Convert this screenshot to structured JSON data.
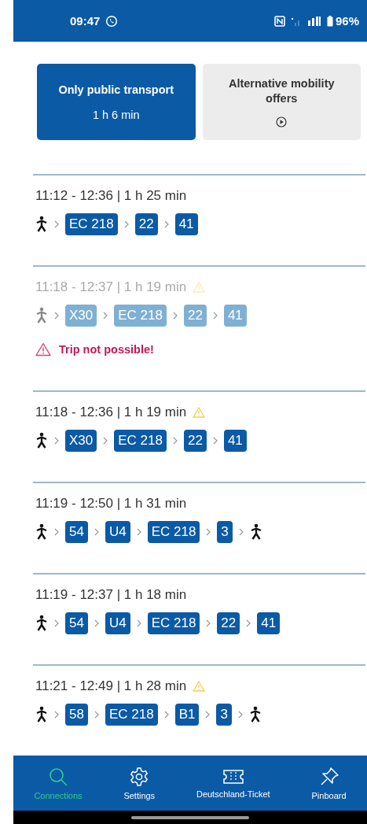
{
  "status_bar": {
    "time": "09:47",
    "battery": "96%"
  },
  "tabs": [
    {
      "label": "Only public transport",
      "detail": "1 h 6 min",
      "selected": true
    },
    {
      "label": "Alternative mobility offers",
      "selected": false
    }
  ],
  "trips": [
    {
      "times": "11:12 - 12:36 | 1 h 25 min",
      "warning": false,
      "disabled": false,
      "legs": [
        {
          "kind": "walk"
        },
        {
          "kind": "line",
          "label": "EC 218"
        },
        {
          "kind": "line",
          "label": "22"
        },
        {
          "kind": "line",
          "label": "41"
        }
      ]
    },
    {
      "times": "11:18 - 12:37 | 1 h 19 min",
      "warning": true,
      "disabled": true,
      "error": "Trip not possible!",
      "legs": [
        {
          "kind": "walk"
        },
        {
          "kind": "line",
          "label": "X30"
        },
        {
          "kind": "line",
          "label": "EC 218"
        },
        {
          "kind": "line",
          "label": "22"
        },
        {
          "kind": "line",
          "label": "41"
        }
      ]
    },
    {
      "times": "11:18 - 12:36 | 1 h 19 min",
      "warning": true,
      "disabled": false,
      "legs": [
        {
          "kind": "walk"
        },
        {
          "kind": "line",
          "label": "X30"
        },
        {
          "kind": "line",
          "label": "EC 218"
        },
        {
          "kind": "line",
          "label": "22"
        },
        {
          "kind": "line",
          "label": "41"
        }
      ]
    },
    {
      "times": "11:19 - 12:50 | 1 h 31 min",
      "warning": false,
      "disabled": false,
      "legs": [
        {
          "kind": "walk"
        },
        {
          "kind": "line",
          "label": "54"
        },
        {
          "kind": "line",
          "label": "U4"
        },
        {
          "kind": "line",
          "label": "EC 218"
        },
        {
          "kind": "line",
          "label": "3"
        },
        {
          "kind": "walk"
        }
      ]
    },
    {
      "times": "11:19 - 12:37 | 1 h 18 min",
      "warning": false,
      "disabled": false,
      "legs": [
        {
          "kind": "walk"
        },
        {
          "kind": "line",
          "label": "54"
        },
        {
          "kind": "line",
          "label": "U4"
        },
        {
          "kind": "line",
          "label": "EC 218"
        },
        {
          "kind": "line",
          "label": "22"
        },
        {
          "kind": "line",
          "label": "41"
        }
      ]
    },
    {
      "times": "11:21 - 12:49 | 1 h 28 min",
      "warning": true,
      "disabled": false,
      "legs": [
        {
          "kind": "walk"
        },
        {
          "kind": "line",
          "label": "58"
        },
        {
          "kind": "line",
          "label": "EC 218"
        },
        {
          "kind": "line",
          "label": "B1"
        },
        {
          "kind": "line",
          "label": "3"
        },
        {
          "kind": "walk"
        }
      ]
    }
  ],
  "nav": [
    {
      "kind": "search",
      "label": "Connections",
      "selected": true
    },
    {
      "kind": "settings",
      "label": "Settings",
      "selected": false
    },
    {
      "kind": "ticket",
      "label": "Deutschland-Ticket",
      "selected": false
    },
    {
      "kind": "pin",
      "label": "Pinboard",
      "selected": false
    }
  ]
}
